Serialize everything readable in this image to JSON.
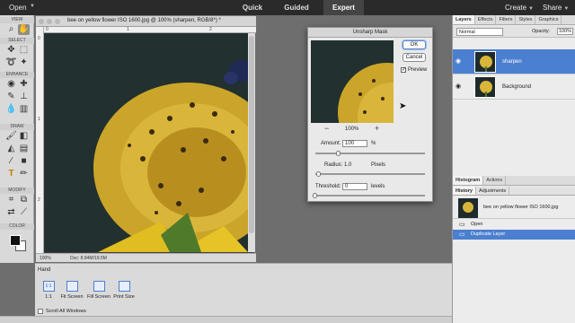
{
  "topbar": {
    "open_label": "Open",
    "modes": [
      "Quick",
      "Guided",
      "Expert"
    ],
    "active_mode": "Expert",
    "create_label": "Create",
    "share_label": "Share"
  },
  "toolbox": {
    "sections": [
      "VIEW",
      "SELECT",
      "ENHANCE",
      "DRAW",
      "MODIFY",
      "COLOR"
    ]
  },
  "document": {
    "title": "bee on yellow flower ISO 1600.jpg @ 100% (sharpen, RGB/8*) *",
    "ruler_top": [
      "0",
      "1",
      "2"
    ],
    "ruler_left": [
      "0",
      "1",
      "2"
    ],
    "zoom": "100%",
    "doc_info": "Doc: 8.84M/19.5M"
  },
  "dialog": {
    "title": "Unsharp Mask",
    "ok_label": "OK",
    "cancel_label": "Cancel",
    "preview_label": "Preview",
    "preview_checked": "✓",
    "zoom_out_icon": "−",
    "zoom_in_icon": "+",
    "zoom": "100%",
    "amount_label": "Amount:",
    "amount_value": "100",
    "amount_unit": "%",
    "amount_fraction": 0.2,
    "radius_label": "Radius:",
    "radius_value": "1.0",
    "radius_unit": "Pixels",
    "radius_fraction": 0.02,
    "threshold_label": "Threshold:",
    "threshold_value": "0",
    "threshold_unit": "levels",
    "threshold_fraction": 0
  },
  "layers_panel": {
    "tabs": [
      "Layers",
      "Effects",
      "Filters",
      "Styles",
      "Graphics"
    ],
    "active_tab": "Layers",
    "blend_mode": "Normal",
    "opacity_label": "Opacity:",
    "opacity_value": "100%",
    "layers": [
      {
        "name": "sharpen",
        "selected": true
      },
      {
        "name": "Background",
        "selected": false
      }
    ]
  },
  "history_panel": {
    "tabs": [
      "Histogram",
      "Actions"
    ],
    "sub_tabs": [
      "History",
      "Adjustments"
    ],
    "snapshot": "bee on yellow flower ISO 1600.jpg",
    "states": [
      "Open",
      "Duplicate Layer"
    ],
    "selected_state": "Duplicate Layer"
  },
  "options_bar": {
    "tool_name": "Hand",
    "buttons": [
      {
        "icon": "1:1",
        "label": "1:1"
      },
      {
        "icon": "",
        "label": "Fit Screen"
      },
      {
        "icon": "",
        "label": "Fill Screen"
      },
      {
        "icon": "",
        "label": "Print Size"
      }
    ],
    "scroll_all_label": "Scroll All Windows"
  }
}
